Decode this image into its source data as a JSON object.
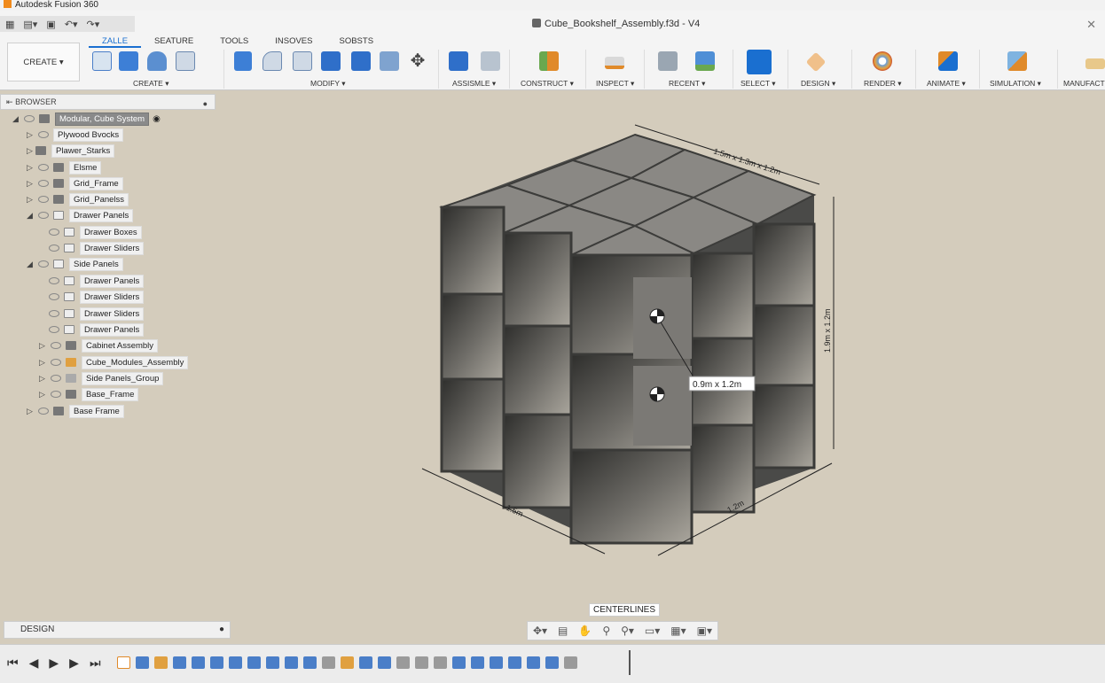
{
  "app": {
    "title": "Autodesk Fusion 360"
  },
  "document": {
    "title": "Cube_Bookshelf_Assembly.f3d - V4"
  },
  "tabs": [
    "ZALLE",
    "SEATURE",
    "TOOLS",
    "INSOVES",
    "SOBSTS"
  ],
  "create_button": "CREATE ▾",
  "groups": {
    "create": "CREATE ▾",
    "modify": "MODIFY ▾",
    "assemble": "ASSISMLE ▾",
    "construct": "CONSTRUCT ▾",
    "inspect": "INSPECT ▾",
    "recent": "RECENT ▾",
    "select": "SELECT ▾",
    "design": "DESIGN ▾",
    "render": "RENDER ▾",
    "animate": "ANIMATE ▾",
    "simulation": "SIMULATION ▾",
    "manufacture": "MANUFACT"
  },
  "browser": {
    "header": "BROWSER",
    "items": [
      {
        "label": "Modular, Cube System"
      },
      {
        "label": "Plywood Bvocks"
      },
      {
        "label": "Plawer_Starks"
      },
      {
        "label": "Elsme"
      },
      {
        "label": "Grid_Frame"
      },
      {
        "label": "Grid_Panelss"
      },
      {
        "label": "Drawer Panels"
      },
      {
        "label": "Drawer Boxes"
      },
      {
        "label": "Drawer Sliders"
      },
      {
        "label": "Side Panels"
      },
      {
        "label": "Drawer Panels"
      },
      {
        "label": "Drawer Sliders"
      },
      {
        "label": "Drawer Sliders"
      },
      {
        "label": "Drawer Panels"
      },
      {
        "label": "Cabinet Assembly"
      },
      {
        "label": "Cube_Modules_Assembly"
      },
      {
        "label": "Side Panels_Group"
      },
      {
        "label": "Base_Frame"
      },
      {
        "label": "Base Frame"
      }
    ]
  },
  "viewport": {
    "dim_top": "1.5m x 1.3m x 1.2m",
    "dim_right": "1.9m x 1.2m",
    "dim_callout": "0.9m x 1.2m",
    "dim_bottom_left": "1.5m",
    "dim_bottom_right": "1.2m",
    "centerlines": "CENTERLINES"
  },
  "design_panel": {
    "label": "DESIGN"
  },
  "colors": {
    "accent": "#1a6fd0",
    "canvas": "#d4ccbc",
    "cube": "#5e5e5c"
  }
}
